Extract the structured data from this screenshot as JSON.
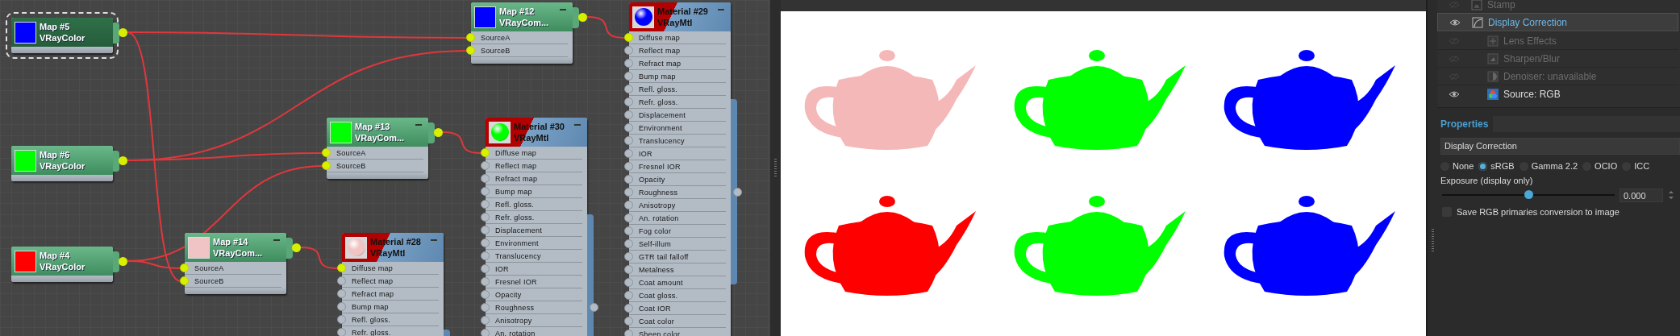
{
  "node_editor": {
    "nodes": [
      {
        "title": "Map #5",
        "type": "VRayColor",
        "kind": "map",
        "color": "#0000ff",
        "selected": true
      },
      {
        "title": "Map #6",
        "type": "VRayColor",
        "kind": "map",
        "color": "#00ff00",
        "selected": false
      },
      {
        "title": "Map #4",
        "type": "VRayColor",
        "kind": "map",
        "color": "#ff0000",
        "selected": false
      },
      {
        "title": "Map #14",
        "type": "VRayCom...",
        "kind": "map",
        "color": "#f0c4c4",
        "selected": false,
        "ports": [
          "SourceA",
          "SourceB"
        ]
      },
      {
        "title": "Map #13",
        "type": "VRayCom...",
        "kind": "map",
        "color": "#00ff00",
        "selected": false,
        "ports": [
          "SourceA",
          "SourceB"
        ]
      },
      {
        "title": "Material #28",
        "type": "VRayMtl",
        "kind": "material",
        "color": "#f0c4c4",
        "selected": false,
        "ports": [
          "Diffuse map",
          "Reflect map",
          "Refract map",
          "Bump map",
          "Refl. gloss.",
          "Refr. gloss."
        ]
      },
      {
        "title": "Map #12",
        "type": "VRayCom...",
        "kind": "map",
        "color": "#0000ff",
        "selected": false,
        "ports": [
          "SourceA",
          "SourceB"
        ]
      },
      {
        "title": "Material #30",
        "type": "VRayMtl",
        "kind": "material",
        "color": "#00ff00",
        "selected": false,
        "ports": [
          "Diffuse map",
          "Reflect map",
          "Refract map",
          "Bump map",
          "Refl. gloss.",
          "Refr. gloss.",
          "Displacement",
          "Environment",
          "Translucency",
          "IOR",
          "Fresnel IOR",
          "Opacity",
          "Roughness",
          "Anisotropy",
          "An. rotation"
        ]
      },
      {
        "title": "Material #29",
        "type": "VRayMtl",
        "kind": "material",
        "color": "#0000ff",
        "selected": false,
        "ports": [
          "Diffuse map",
          "Reflect map",
          "Refract map",
          "Bump map",
          "Refl. gloss.",
          "Refr. gloss.",
          "Displacement",
          "Environment",
          "Translucency",
          "IOR",
          "Fresnel IOR",
          "Opacity",
          "Roughness",
          "Anisotropy",
          "An. rotation",
          "Fog color",
          "Self-illum",
          "GTR tail falloff",
          "Metalness",
          "Coat amount",
          "Coat gloss.",
          "Coat IOR",
          "Coat color",
          "Sheen color"
        ]
      }
    ]
  },
  "render": {
    "teapots": [
      {
        "color": "#f5b8b8"
      },
      {
        "color": "#00ff00"
      },
      {
        "color": "#0000ff"
      },
      {
        "color": "#ff0000"
      },
      {
        "color": "#00ff00"
      },
      {
        "color": "#0000ff"
      }
    ]
  },
  "panel": {
    "layers": [
      {
        "label": "Stamp",
        "visible": false,
        "selected": false
      },
      {
        "label": "Display Correction",
        "visible": true,
        "selected": true,
        "children": [
          {
            "label": "Lens Effects",
            "visible": false,
            "selected": false
          },
          {
            "label": "Sharpen/Blur",
            "visible": false,
            "selected": false
          },
          {
            "label": "Denoiser: unavailable",
            "visible": false,
            "selected": false
          },
          {
            "label": "Source: RGB",
            "visible": true,
            "selected": false
          }
        ]
      }
    ],
    "properties": {
      "title": "Properties",
      "dropdown": "Display Correction",
      "options": [
        {
          "label": "None",
          "selected": false
        },
        {
          "label": "sRGB",
          "selected": true
        },
        {
          "label": "Gamma 2.2",
          "selected": false
        },
        {
          "label": "OCIO",
          "selected": false
        },
        {
          "label": "ICC",
          "selected": false
        }
      ],
      "exposure_label": "Exposure (display only)",
      "exposure": {
        "level": 0.5,
        "value": "0.000"
      },
      "save_primaries": {
        "label": "Save RGB primaries conversion to image",
        "checked": false
      }
    }
  }
}
